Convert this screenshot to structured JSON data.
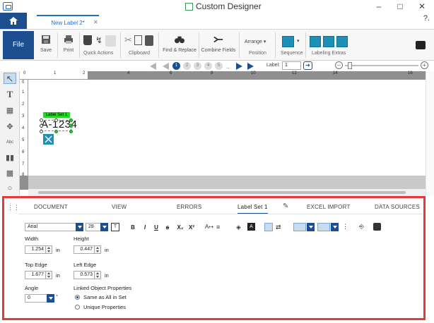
{
  "window": {
    "title": "Custom Designer",
    "help": "?."
  },
  "tabs": {
    "document_tab": "New Label 2*"
  },
  "ribbon": {
    "file": "File",
    "save": "Save",
    "print": "Print",
    "quick_actions": "Quick Actions",
    "clipboard": "Clipboard",
    "find_replace": "Find & Replace",
    "combine_fields": "Combine Fields",
    "arrange": "Arrange",
    "position": "Position",
    "sequence": "Sequence",
    "labeling_extras": "Labeling Extras"
  },
  "nav": {
    "pages": [
      "1",
      "2",
      "3",
      "4",
      "5"
    ],
    "ellipsis": "..",
    "label_caption": "Label:",
    "label_value": "1"
  },
  "ruler": {
    "h_ticks": [
      "0",
      "1",
      "2",
      "4",
      "6",
      "8",
      "10",
      "12",
      "14",
      "16"
    ],
    "v_ticks": [
      "0",
      "1",
      "2",
      "3",
      "4",
      "5",
      "6",
      "7",
      "8"
    ]
  },
  "canvas": {
    "set_label": "Label Set 1",
    "object_text": "A-1234"
  },
  "panel": {
    "tabs": [
      "DOCUMENT",
      "VIEW",
      "ERRORS",
      "Label Set 1",
      "EXCEL IMPORT",
      "DATA SOURCES"
    ],
    "font": "Arial",
    "font_size": "28",
    "format_buttons": [
      "B",
      "I",
      "U",
      "ꞩ",
      "X₂",
      "X²"
    ],
    "width_label": "Width",
    "width_value": "1.254",
    "width_unit": "in",
    "height_label": "Height",
    "height_value": "0.447",
    "height_unit": "in",
    "top_edge_label": "Top Edge",
    "top_edge_value": "1.677",
    "top_edge_unit": "in",
    "left_edge_label": "Left Edge",
    "left_edge_value": "0.573",
    "left_edge_unit": "in",
    "angle_label": "Angle",
    "angle_value": "0",
    "angle_unit": "°",
    "linked_label": "Linked Object Properties",
    "opt_same": "Same as All in Set",
    "opt_unique": "Unique Properties"
  },
  "colors": {
    "accent": "#1d4e8f",
    "highlight": "#ea3838",
    "set_green": "#23d623",
    "teal": "#1e8fb8"
  }
}
